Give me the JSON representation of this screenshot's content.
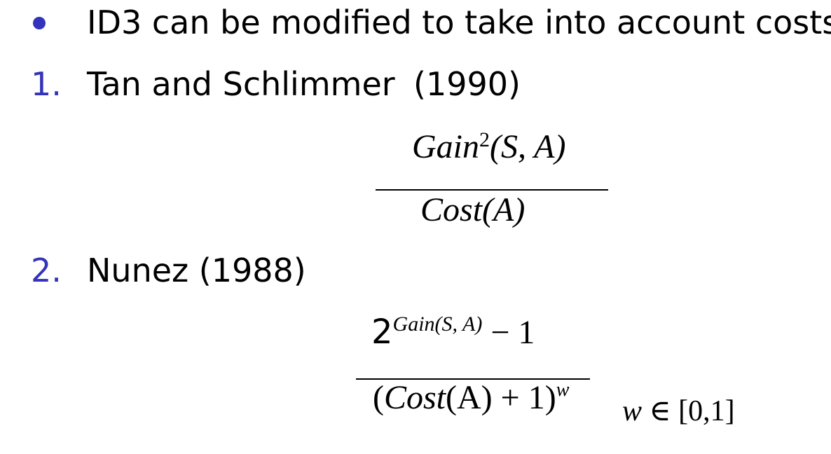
{
  "slide": {
    "bullet": {
      "text": "ID3 can be modified to take into account costs:"
    },
    "item1": {
      "number": "1.",
      "authors": "Tan and Schlimmer",
      "year": "(1990)",
      "formula": {
        "num_fn": "Gain",
        "num_exp": "2",
        "num_args": "(S, A)",
        "den_fn": "Cost",
        "den_args": "(A)"
      }
    },
    "item2": {
      "number": "2.",
      "text": "Nunez (1988)",
      "formula": {
        "base": "2",
        "exponent_fn": "Gain",
        "exponent_args": "(S, A)",
        "minus": " − 1",
        "den_open": "(",
        "den_fn": "Cost",
        "den_args": "(A) + 1)",
        "den_exp": "w",
        "constraint_var": "w",
        "constraint_rest": " ∈ [0,1]"
      }
    },
    "colors": {
      "accent": "#3333bb",
      "text": "#000000",
      "background": "#ffffff"
    }
  }
}
